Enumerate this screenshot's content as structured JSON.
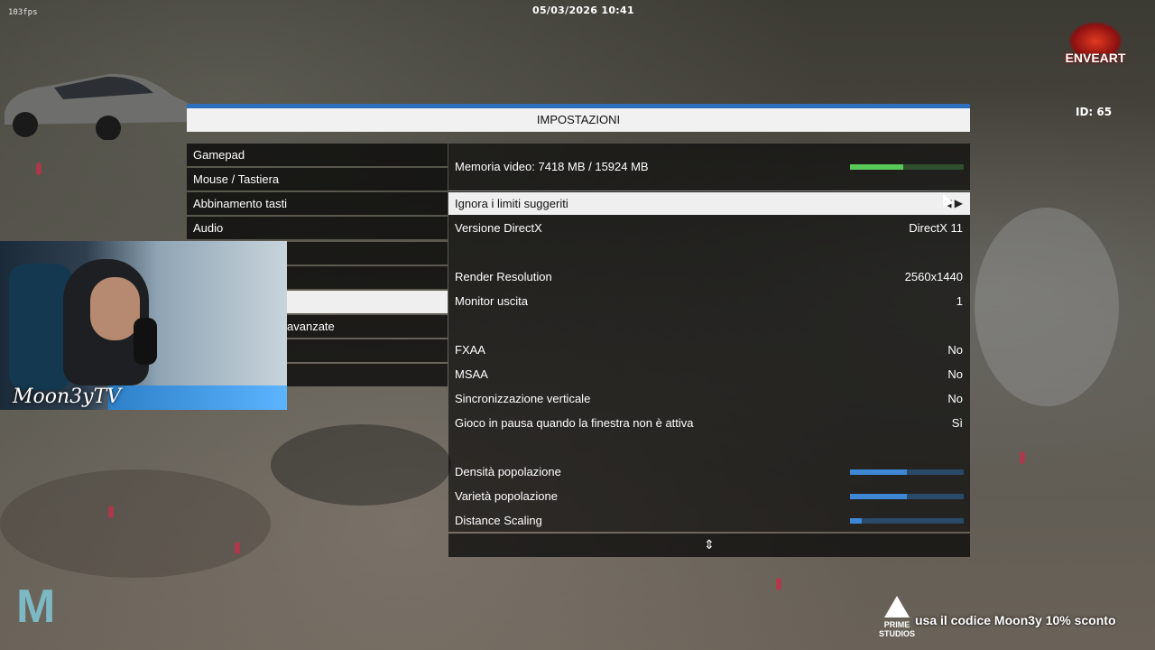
{
  "hud": {
    "fps": "103fps",
    "datetime": "05/03/2026 10:41",
    "player_id": "ID: 65",
    "server_logo": "ENVEART"
  },
  "panel": {
    "title": "IMPOSTAZIONI"
  },
  "menu": {
    "items": [
      {
        "label": "Gamepad"
      },
      {
        "label": "Mouse / Tastiera"
      },
      {
        "label": "Abbinamento tasti"
      },
      {
        "label": "Audio"
      }
    ],
    "partial_item": "avanzate"
  },
  "settings": {
    "video_memory": {
      "label": "Memoria video: 7418 MB / 15924 MB",
      "fraction": 0.466
    },
    "ignore_limits": {
      "label": "Ignora i limiti suggeriti"
    },
    "directx": {
      "label": "Versione DirectX",
      "value": "DirectX 11"
    },
    "render_resolution": {
      "label": "Render Resolution",
      "value": "2560x1440"
    },
    "output_monitor": {
      "label": "Monitor uscita",
      "value": "1"
    },
    "fxaa": {
      "label": "FXAA",
      "value": "No"
    },
    "msaa": {
      "label": "MSAA",
      "value": "No"
    },
    "vsync": {
      "label": "Sincronizzazione verticale",
      "value": "No"
    },
    "pause_focus": {
      "label": "Gioco in pausa quando la finestra non è attiva",
      "value": "Sì"
    },
    "population_density": {
      "label": "Densità popolazione",
      "fraction": 0.5
    },
    "population_variety": {
      "label": "Varietà popolazione",
      "fraction": 0.5
    },
    "distance_scaling": {
      "label": "Distance Scaling",
      "fraction": 0.1
    }
  },
  "overlay": {
    "streamer_name": "Moon3yTV",
    "logo_left": "M",
    "prime_logo": "PRIME STUDIOS",
    "promo_text": "usa il codice Moon3y 10% sconto"
  },
  "colors": {
    "accent_blue": "#2e6fbd",
    "slider_blue": "#3d87d6",
    "memory_green": "#59c95a"
  },
  "icons": {
    "scroll": "up-down-chevron-icon",
    "option_arrows": "left-right-arrow-icon"
  }
}
